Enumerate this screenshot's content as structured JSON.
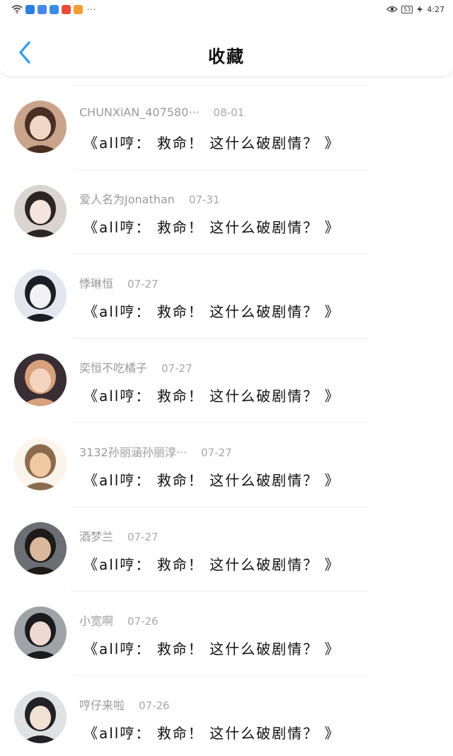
{
  "status_bar": {
    "time": "4:27",
    "battery": "53",
    "more": "···",
    "app_colors": [
      "#2a7de1",
      "#4a86e8",
      "#3b8ee8",
      "#e94b3c",
      "#f39c33"
    ]
  },
  "header": {
    "title": "收藏",
    "back_color": "#2c9cf0"
  },
  "items": [
    {
      "username": "CHUNXiAN_407580···",
      "date": "08-01",
      "quote": "《all哼： 救命！ 这什么破剧情？ 》",
      "avatar_colors": [
        "#c9a48a",
        "#4a2f25",
        "#f0d6c4"
      ]
    },
    {
      "username": "爱人名为Jonathan",
      "date": "07-31",
      "quote": "《all哼： 救命！ 这什么破剧情？ 》",
      "avatar_colors": [
        "#d9d4d0",
        "#2b2524",
        "#f3e4de"
      ]
    },
    {
      "username": "悸琳恒",
      "date": "07-27",
      "quote": "《all哼： 救命！ 这什么破剧情？ 》",
      "avatar_colors": [
        "#e3e6ee",
        "#1d1d25",
        "#f2f2f6"
      ]
    },
    {
      "username": "奕恒不吃橘子",
      "date": "07-27",
      "quote": "《all哼： 救命！ 这什么破剧情？ 》",
      "avatar_colors": [
        "#3a2e35",
        "#d8a07c",
        "#f4d4c0"
      ]
    },
    {
      "username": "3132孙丽涵孙丽淳···",
      "date": "07-27",
      "quote": "《all哼： 救命！ 这什么破剧情？ 》",
      "avatar_colors": [
        "#fbf4ea",
        "#8b6a4e",
        "#f1c9a0"
      ]
    },
    {
      "username": "酒梦兰",
      "date": "07-27",
      "quote": "《all哼： 救命！ 这什么破剧情？ 》",
      "avatar_colors": [
        "#6b6f74",
        "#1d1a18",
        "#d9b89c"
      ]
    },
    {
      "username": "小宽啊",
      "date": "07-26",
      "quote": "《all哼： 救命！ 这什么破剧情？ 》",
      "avatar_colors": [
        "#9fa3a8",
        "#1b1b1e",
        "#ecd9d2"
      ]
    },
    {
      "username": "哼仔来啦",
      "date": "07-26",
      "quote": "《all哼： 救命！ 这什么破剧情？ 》",
      "avatar_colors": [
        "#dfe1e3",
        "#222226",
        "#f1e0d4"
      ]
    }
  ]
}
